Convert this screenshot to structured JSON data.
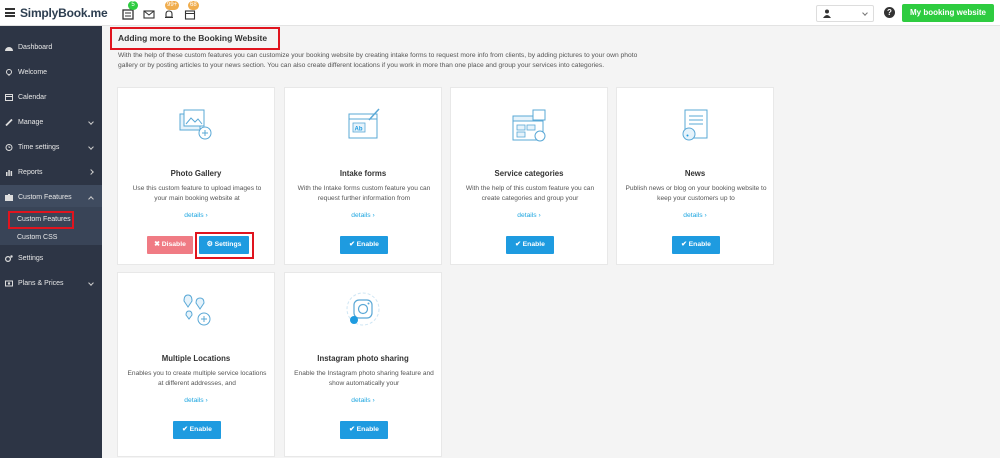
{
  "topbar": {
    "logo": "SimplyBook.me",
    "badges": {
      "notifications": "5",
      "bell": "99+",
      "calendar": "68"
    },
    "my_booking_label": "My booking website"
  },
  "sidebar": {
    "items": [
      {
        "label": "Dashboard",
        "icon": "dashboard-icon"
      },
      {
        "label": "Welcome",
        "icon": "bulb-icon"
      },
      {
        "label": "Calendar",
        "icon": "calendar-icon"
      },
      {
        "label": "Manage",
        "icon": "pencil-icon"
      },
      {
        "label": "Time settings",
        "icon": "clock-icon"
      },
      {
        "label": "Reports",
        "icon": "bar-chart-icon"
      },
      {
        "label": "Custom Features",
        "icon": "puzzle-icon"
      },
      {
        "label": "Settings",
        "icon": "gears-icon"
      },
      {
        "label": "Plans & Prices",
        "icon": "money-icon"
      }
    ],
    "sub_items": [
      "Custom Features",
      "Custom CSS"
    ]
  },
  "main": {
    "title": "Adding more to the Booking Website",
    "description": "With the help of these custom features you can customize your booking website by creating intake forms to request more info from clients, by adding pictures to your own photo gallery or by posting articles to your news section. You can also create different locations if you work in more than one place and group your services into categories.",
    "cards": [
      {
        "name": "Photo Gallery",
        "desc": "Use this custom feature to upload images to your main booking website at",
        "link": "details ›",
        "state": "enabled",
        "disable_label": "✖ Disable",
        "settings_label": "⚙ Settings"
      },
      {
        "name": "Intake forms",
        "desc": "With the Intake forms custom feature you can request further information from",
        "link": "details ›",
        "enable_label": "✔ Enable"
      },
      {
        "name": "Service categories",
        "desc": "With the help of this custom feature you can create categories and group your",
        "link": "details ›",
        "enable_label": "✔ Enable"
      },
      {
        "name": "News",
        "desc": "Publish news or blog on your booking website to keep your customers up to",
        "link": "details ›",
        "enable_label": "✔ Enable"
      },
      {
        "name": "Multiple Locations",
        "desc": "Enables you to create multiple service locations at different addresses, and",
        "link": "details ›",
        "enable_label": "✔ Enable"
      },
      {
        "name": "Instagram photo sharing",
        "desc": "Enable the Instagram photo sharing feature and show automatically your",
        "link": "details ›",
        "enable_label": "✔ Enable"
      }
    ]
  },
  "colors": {
    "accent": "#1e9be0",
    "green": "#2ecc40",
    "sidebar": "#2d3545",
    "highlight": "#e0141e"
  }
}
